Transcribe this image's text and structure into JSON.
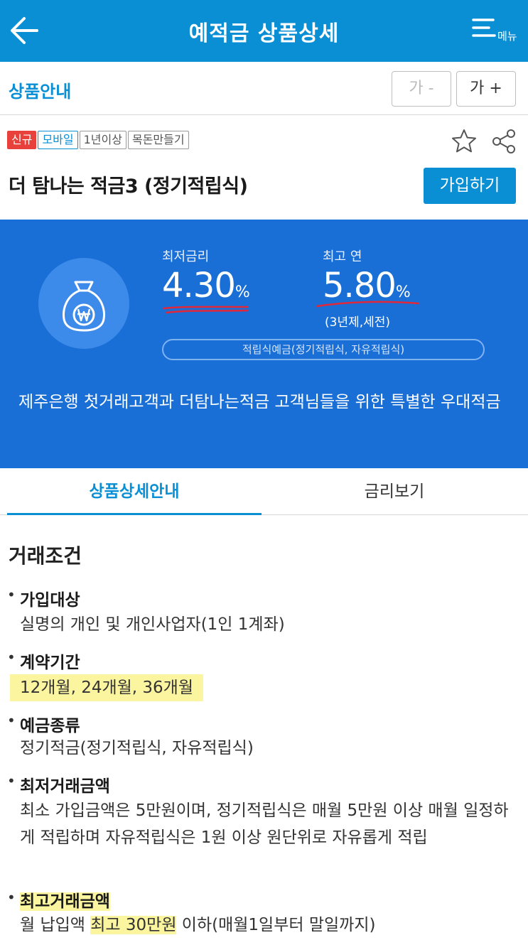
{
  "header": {
    "title": "예적금 상품상세",
    "menu_label": "메뉴"
  },
  "section": {
    "title": "상품안내",
    "font_minus": "가 -",
    "font_plus": "가 +"
  },
  "product": {
    "tags": [
      "신규",
      "모바일",
      "1년이상",
      "목돈만들기"
    ],
    "name": "더 탐나는 적금3 (정기적립식)",
    "join_label": "가입하기"
  },
  "rates": {
    "min_label": "최저금리",
    "min_value": "4.30",
    "max_label": "최고 연",
    "max_value": "5.80",
    "unit": "%",
    "max_note": "(3년제,세전)",
    "product_type": "적립식예금(정기적립식, 자유적립식)",
    "description": "제주은행 첫거래고객과 더탐나는적금 고객님들을 위한 특별한 우대적금"
  },
  "tabs": [
    "상품상세안내",
    "금리보기"
  ],
  "content": {
    "title": "거래조건",
    "bullet": "•",
    "items": [
      {
        "title": "가입대상",
        "text": "실명의 개인 및 개인사업자(1인 1계좌)"
      },
      {
        "title": "계약기간",
        "text": "12개월, 24개월, 36개월"
      },
      {
        "title": "예금종류",
        "text": "정기적금(정기적립식, 자유적립식)"
      },
      {
        "title": "최저거래금액",
        "text": "최소 가입금액은 5만원이며, 정기적립식은 매월 5만원 이상 매월 일정하게 적립하며 자유적립식은 1원 이상 원단위로 자유롭게 적립"
      },
      {
        "title": "최고거래금액",
        "text_before": "월 납입액 ",
        "text_highlight": "최고 30만원",
        "text_after": " 이하(매월1일부터 말일까지)"
      }
    ]
  },
  "colors": {
    "brand": "#0a8fd4",
    "panel": "#1a6fd6",
    "new_tag": "#e8413c",
    "highlight": "#fbf5a0",
    "underline": "#e0283a"
  },
  "icons": [
    "back-arrow-icon",
    "hamburger-menu-icon",
    "star-icon",
    "share-icon",
    "money-bag-won-icon"
  ]
}
